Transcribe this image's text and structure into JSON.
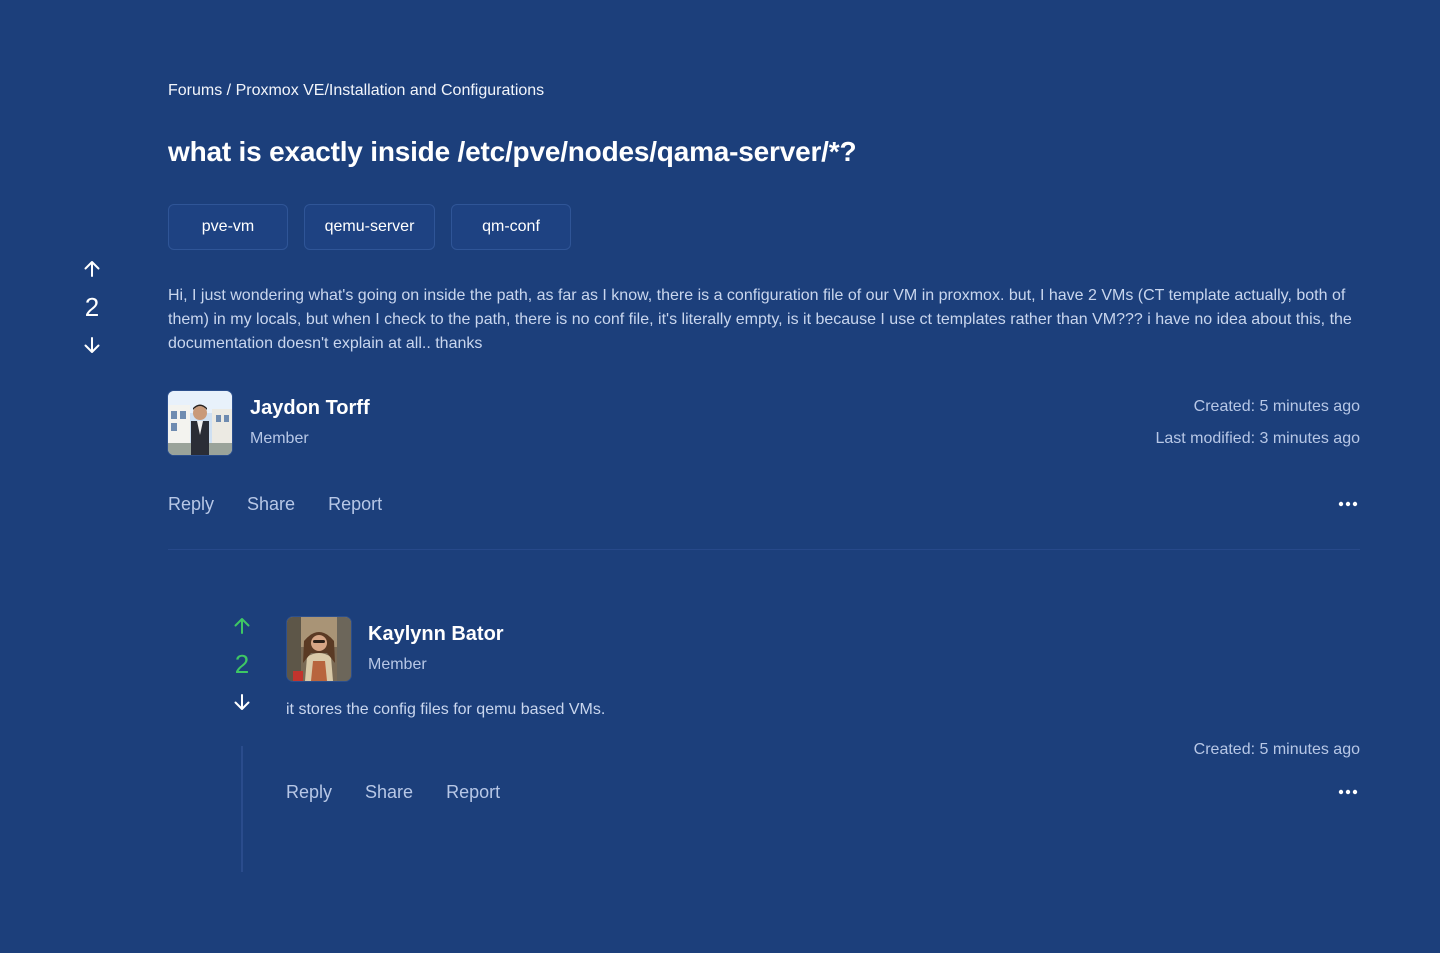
{
  "breadcrumb": "Forums / Proxmox VE/Installation and Configurations",
  "title": "what is exactly inside /etc/pve/nodes/qama-server/*?",
  "tags": [
    "pve-vm",
    "qemu-server",
    "qm-conf"
  ],
  "post": {
    "votes": "2",
    "body": "Hi, I just wondering what's going on inside the path, as far as I know, there is a configuration file of our VM in proxmox. but, I have 2 VMs (CT template actually, both of them) in my locals, but when I check to the path, there is no conf file, it's literally empty, is it because I use ct templates rather than VM??? i have no idea about this, the documentation doesn't explain at all.. thanks",
    "author": {
      "name": "Jaydon Torff",
      "role": "Member"
    },
    "created": "Created: 5 minutes ago",
    "modified": "Last modified: 3 minutes ago",
    "actions": {
      "reply": "Reply",
      "share": "Share",
      "report": "Report"
    }
  },
  "reply": {
    "votes": "2",
    "author": {
      "name": "Kaylynn Bator",
      "role": "Member"
    },
    "body": "it stores the config files for qemu based VMs.",
    "created": "Created: 5 minutes ago",
    "actions": {
      "reply": "Reply",
      "share": "Share",
      "report": "Report"
    }
  },
  "colors": {
    "background": "#1c3f7b",
    "upvote_active": "#3ec764",
    "muted_text": "#b7c7e6"
  },
  "icons": [
    "arrow-up-icon",
    "arrow-down-icon",
    "more-horizontal-icon"
  ]
}
